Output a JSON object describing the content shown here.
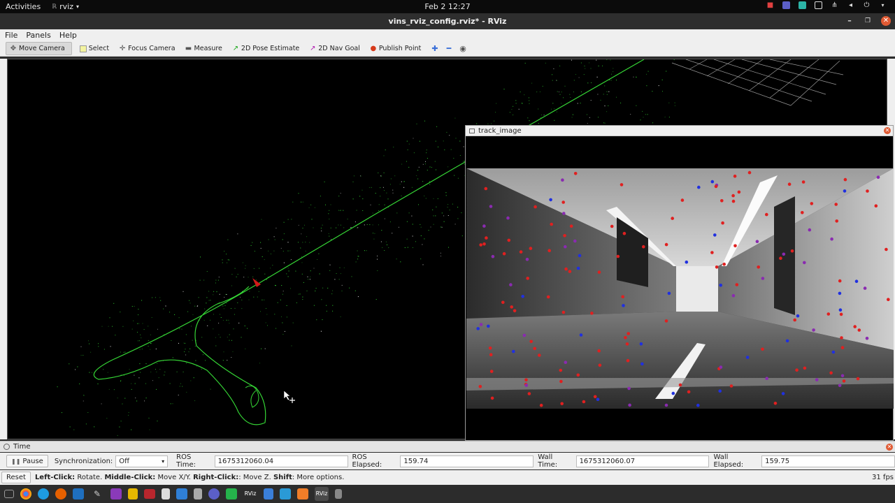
{
  "topbar": {
    "activities": "Activities",
    "app_name": "rviz",
    "clock": "Feb 2  12:27"
  },
  "window": {
    "title": "vins_rviz_config.rviz* - RViz"
  },
  "menu": {
    "file": "File",
    "panels": "Panels",
    "help": "Help"
  },
  "toolbar": {
    "move_camera": "Move Camera",
    "select": "Select",
    "focus_camera": "Focus Camera",
    "measure": "Measure",
    "pose_estimate": "2D Pose Estimate",
    "nav_goal": "2D Nav Goal",
    "publish_point": "Publish Point"
  },
  "track_panel": {
    "title": "track_image"
  },
  "time_panel": {
    "title": "Time",
    "pause_label": "Pause",
    "sync_label": "Synchronization:",
    "sync_value": "Off",
    "ros_time_label": "ROS Time:",
    "ros_time": "1675312060.04",
    "ros_elapsed_label": "ROS Elapsed:",
    "ros_elapsed": "159.74",
    "wall_time_label": "Wall Time:",
    "wall_time": "1675312060.07",
    "wall_elapsed_label": "Wall Elapsed:",
    "wall_elapsed": "159.75"
  },
  "status": {
    "reset": "Reset",
    "left_click": "Left-Click:",
    "left_click_desc": " Rotate. ",
    "middle_click": "Middle-Click:",
    "middle_click_desc": " Move X/Y. ",
    "right_click": "Right-Click:",
    "right_click_desc": ": Move Z. ",
    "shift": "Shift",
    "shift_desc": ": More options.",
    "fps": "31 fps"
  },
  "colors": {
    "trajectory": "#33dd33",
    "feature_tracked": "#e02020",
    "feature_new": "#2030e0",
    "feature_mid": "#8a2bb0"
  }
}
